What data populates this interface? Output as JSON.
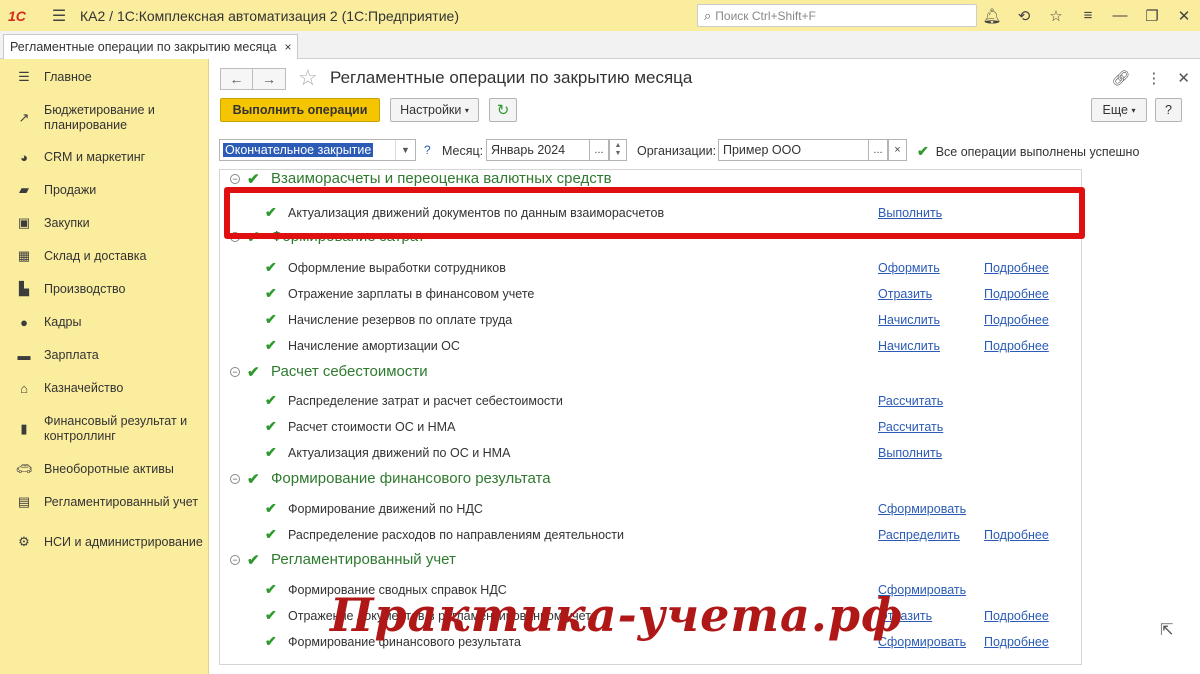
{
  "titlebar": {
    "logo": "1С",
    "app_title": "КА2 / 1С:Комплексная автоматизация 2  (1С:Предприятие)",
    "search_placeholder": "Поиск Ctrl+Shift+F",
    "icons": [
      "bell-icon",
      "history-icon",
      "star-icon",
      "menu-icon",
      "minimize-icon",
      "restore-icon",
      "close-icon"
    ]
  },
  "tab": {
    "label": "Регламентные операции по закрытию месяца",
    "close": "×"
  },
  "sidebar": {
    "items": [
      {
        "label": "Главное",
        "icon": "menu-icon"
      },
      {
        "label": "Бюджетирование и планирование",
        "icon": "chart-icon"
      },
      {
        "label": "CRM и маркетинг",
        "icon": "pie-icon"
      },
      {
        "label": "Продажи",
        "icon": "bag-icon"
      },
      {
        "label": "Закупки",
        "icon": "cart-icon"
      },
      {
        "label": "Склад и доставка",
        "icon": "warehouse-icon"
      },
      {
        "label": "Производство",
        "icon": "factory-icon"
      },
      {
        "label": "Кадры",
        "icon": "person-icon"
      },
      {
        "label": "Зарплата",
        "icon": "money-icon"
      },
      {
        "label": "Казначейство",
        "icon": "bank-icon"
      },
      {
        "label": "Финансовый результат и контроллинг",
        "icon": "bars-icon"
      },
      {
        "label": "Внеоборотные активы",
        "icon": "car-icon"
      },
      {
        "label": "Регламентированный учет",
        "icon": "book-icon"
      },
      {
        "label": "НСИ и администрирование",
        "icon": "gear-icon"
      }
    ]
  },
  "form": {
    "title": "Регламентные операции по закрытию месяца",
    "run_button": "Выполнить операции",
    "settings_button": "Настройки",
    "more_button": "Еще",
    "help_button": "?",
    "mode_value": "Окончательное закрытие",
    "help_q": "?",
    "month_label": "Месяц:",
    "month_value": "Январь 2024",
    "org_label": "Организации:",
    "org_value": "Пример ООО",
    "status_text": "Все операции выполнены успешно"
  },
  "groups": [
    {
      "title": "Взаиморасчеты и переоценка валютных средств",
      "rows": [
        {
          "label": "Актуализация движений документов по данным взаиморасчетов",
          "action": "Выполнить",
          "more": ""
        }
      ]
    },
    {
      "title": "Формирование затрат",
      "rows": [
        {
          "label": "Оформление выработки сотрудников",
          "action": "Оформить",
          "more": "Подробнее"
        },
        {
          "label": "Отражение зарплаты в финансовом учете",
          "action": "Отразить",
          "more": "Подробнее"
        },
        {
          "label": "Начисление резервов по оплате труда",
          "action": "Начислить",
          "more": "Подробнее"
        },
        {
          "label": "Начисление амортизации ОС",
          "action": "Начислить",
          "more": "Подробнее"
        }
      ]
    },
    {
      "title": "Расчет себестоимости",
      "rows": [
        {
          "label": "Распределение затрат и расчет себестоимости",
          "action": "Рассчитать",
          "more": ""
        },
        {
          "label": "Расчет стоимости ОС и НМА",
          "action": "Рассчитать",
          "more": ""
        },
        {
          "label": "Актуализация движений по ОС и НМА",
          "action": "Выполнить",
          "more": ""
        }
      ]
    },
    {
      "title": "Формирование финансового результата",
      "rows": [
        {
          "label": "Формирование движений по НДС",
          "action": "Сформировать",
          "more": ""
        },
        {
          "label": "Распределение расходов по направлениям деятельности",
          "action": "Распределить",
          "more": "Подробнее"
        }
      ]
    },
    {
      "title": "Регламентированный учет",
      "rows": [
        {
          "label": "Формирование сводных справок НДС",
          "action": "Сформировать",
          "more": ""
        },
        {
          "label": "Отражение документов в регламентированном учете",
          "action": "Отразить",
          "more": "Подробнее"
        },
        {
          "label": "Формирование финансового результата",
          "action": "Сформировать",
          "more": "Подробнее"
        }
      ]
    }
  ],
  "watermark": "Практика-учета.рф",
  "colors": {
    "accent": "#f4c500",
    "sidebar_bg": "#fbed9e",
    "link": "#2b5bb4",
    "ok": "#2e9a2e",
    "highlight": "#e01010",
    "group_title": "#2f7a2f"
  }
}
